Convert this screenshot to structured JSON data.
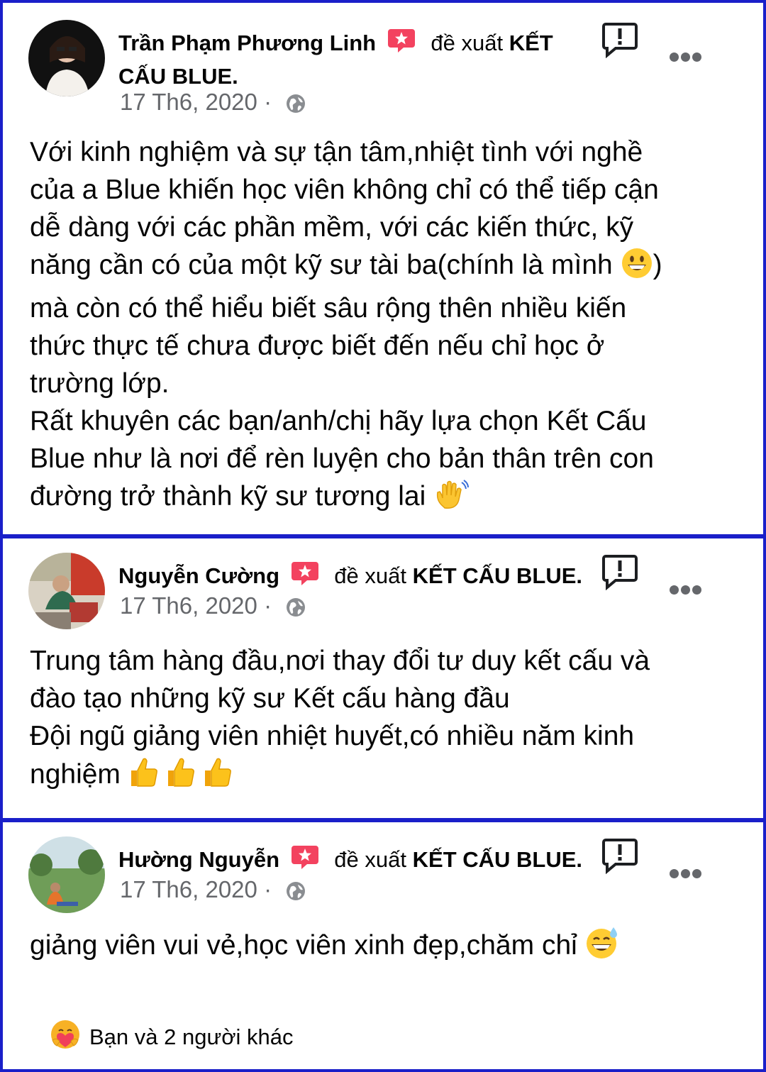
{
  "accent_color": "#1a1fc9",
  "reviews": [
    {
      "author": "Trần Phạm Phương Linh",
      "verb": "đề xuất",
      "page_line1": "KẾT",
      "page_line2": "CẤU BLUE.",
      "date": "17 Th6, 2020",
      "separator": "·",
      "privacy_icon": "globe-icon",
      "body_lines": [
        "Với kinh nghiệm và sự tận tâm,nhiệt tình với nghề",
        "của a Blue khiến học viên không chỉ có thể tiếp cận",
        "dễ dàng với các phần mềm, với các kiến thức, kỹ",
        "năng cần có của một kỹ sư tài ba(chính là mình",
        ")",
        "mà còn có thể hiểu biết sâu rộng thên nhiều kiến",
        "thức thực tế chưa được biết đến nếu chỉ học ở",
        "trường lớp.",
        "Rất khuyên các bạn/anh/chị hãy lựa chọn Kết Cấu",
        "Blue như là nơi để rèn luyện cho bản thân trên con",
        "đường trở thành kỹ sư tương lai"
      ]
    },
    {
      "author": "Nguyễn Cường",
      "verb": "đề xuất",
      "page": "KẾT CẤU BLUE.",
      "date": "17 Th6, 2020",
      "separator": "·",
      "privacy_icon": "globe-icon",
      "body_lines": [
        "Trung tâm hàng đầu,nơi thay đổi tư duy kết cấu và",
        "đào tạo những kỹ sư Kết cấu hàng đầu",
        "Đội ngũ giảng viên nhiệt huyết,có nhiều năm kinh",
        "nghiệm"
      ]
    },
    {
      "author": "Hường Nguyễn",
      "verb": "đề xuất",
      "page": "KẾT CẤU BLUE.",
      "date": "17 Th6, 2020",
      "separator": "·",
      "privacy_icon": "globe-icon",
      "body_lines": [
        "giảng viên vui vẻ,học viên xinh đẹp,chăm chỉ"
      ]
    }
  ],
  "reactions": {
    "icon": "care-reaction-icon",
    "text": "Bạn và 2 người khác"
  }
}
